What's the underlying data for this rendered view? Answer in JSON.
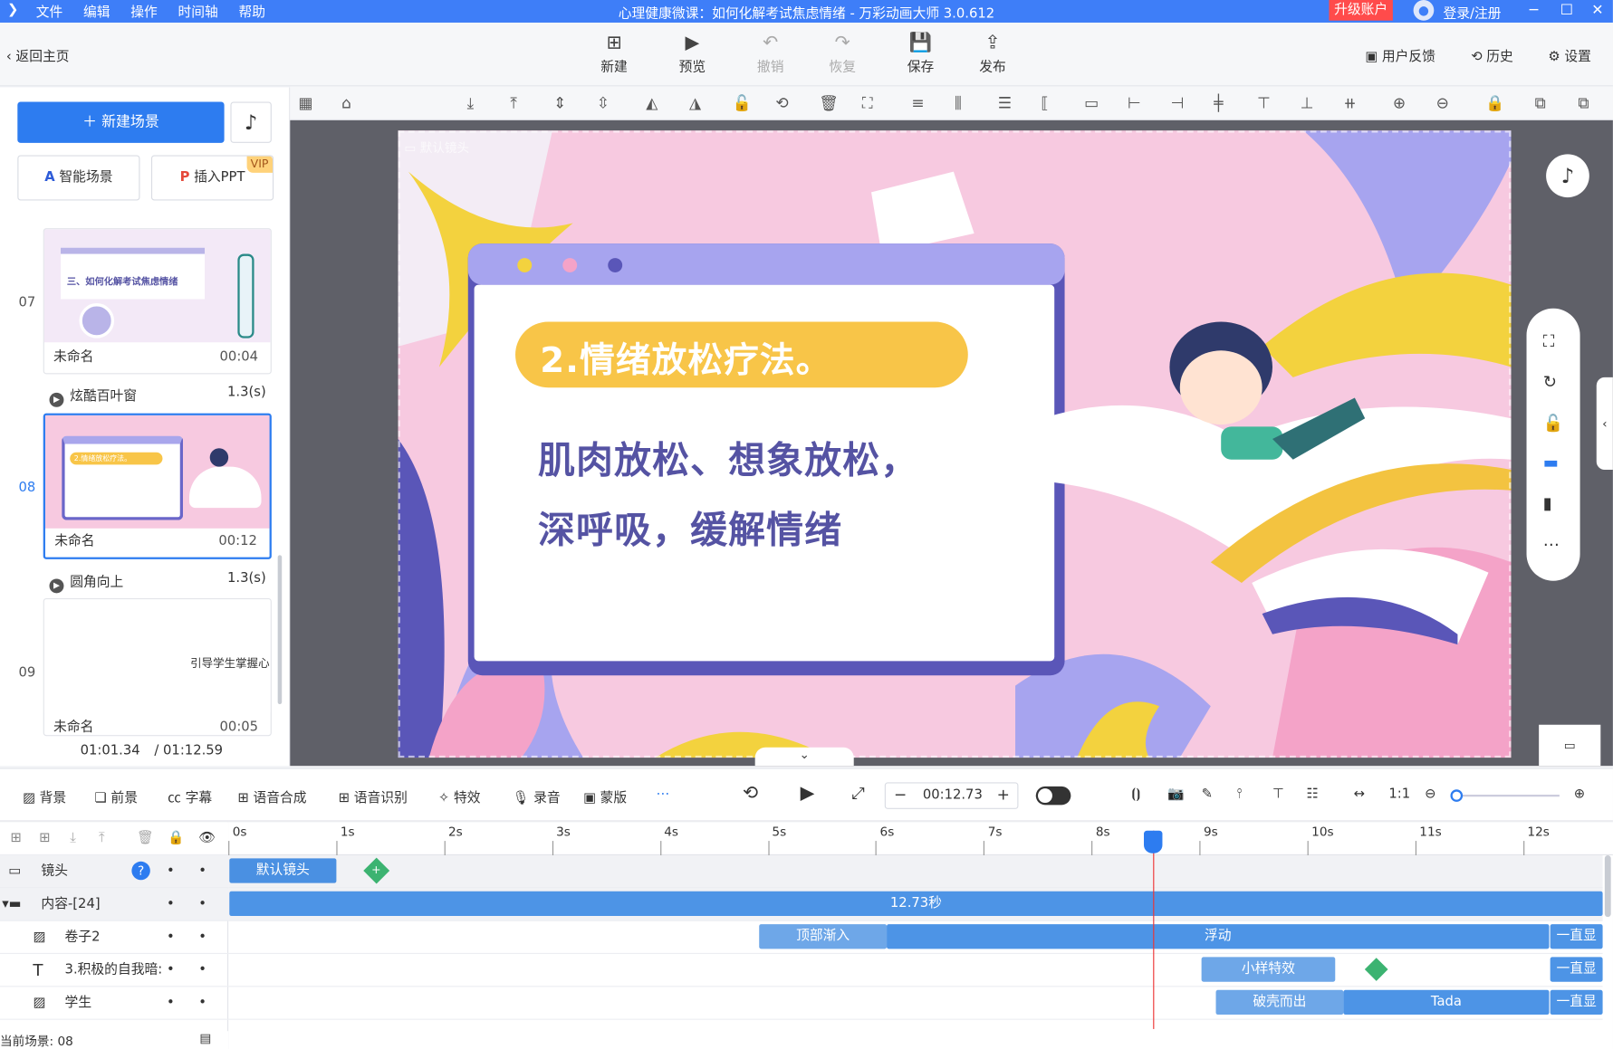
{
  "titlebar": {
    "menus": [
      "文件",
      "编辑",
      "操作",
      "时间轴",
      "帮助"
    ],
    "title": "心理健康微课：如何化解考试焦虑情绪 - 万彩动画大师 3.0.612",
    "upgrade": "升级账户",
    "login": "登录/注册"
  },
  "toolbar": {
    "back": "返回主页",
    "new": "新建",
    "preview": "预览",
    "undo": "撤销",
    "redo": "恢复",
    "save": "保存",
    "publish": "发布",
    "feedback": "用户反馈",
    "history": "历史",
    "settings": "设置"
  },
  "leftpanel": {
    "new_scene": "＋ 新建场景",
    "smart_scene": "智能场景",
    "insert_ppt": "插入PPT",
    "vip": "VIP",
    "scenes": [
      {
        "num": "07",
        "name": "未命名",
        "duration": "00:04",
        "thumb_text": "三、如何化解考试焦虑情绪"
      },
      {
        "num": "08",
        "name": "未命名",
        "duration": "00:12",
        "thumb_text": "2.情绪放松疗法。"
      },
      {
        "num": "09",
        "name": "未命名",
        "duration": "00:05",
        "thumb_text": "引导学生掌握心"
      }
    ],
    "transitions": [
      {
        "name": "炫酷百叶窗",
        "duration": "1.3(s)"
      },
      {
        "name": "圆角向上",
        "duration": "1.3(s)"
      }
    ],
    "time_current": "01:01.34",
    "time_total": "/ 01:12.59"
  },
  "canvas": {
    "camera_label": "默认镜头",
    "heading": "2.情绪放松疗法。",
    "line1": "肌肉放松、想象放松，",
    "line2": "深呼吸，缓解情绪"
  },
  "timeline_toolbar": {
    "background": "背景",
    "foreground": "前景",
    "subtitle": "字幕",
    "tts": "语音合成",
    "asr": "语音识别",
    "effects": "特效",
    "record": "录音",
    "mask": "蒙版",
    "time": "00:12.73"
  },
  "timeline": {
    "ticks": [
      "0s",
      "1s",
      "2s",
      "3s",
      "4s",
      "5s",
      "6s",
      "7s",
      "8s",
      "9s",
      "10s",
      "11s",
      "12s"
    ],
    "tracks": [
      {
        "name": "镜头"
      },
      {
        "name": "内容-[24]"
      },
      {
        "name": "卷子2"
      },
      {
        "name": "3.积极的自我暗:"
      },
      {
        "name": "学生"
      }
    ],
    "blocks": {
      "camera": "默认镜头",
      "content": "12.73秒",
      "juanzi_in": "顶部渐入",
      "juanzi_float": "浮动",
      "always": "一直显",
      "text_fx": "小样特效",
      "student_in": "破壳而出",
      "student_tada": "Tada"
    },
    "playhead_seconds": 8.57,
    "status": "当前场景: 08"
  },
  "colors": {
    "accent": "#2d7cf0",
    "titlebar": "#3e7ef8",
    "canvas_pink": "#f7c9e0",
    "heading_yellow": "#f8c548",
    "text_purple": "#5553a3"
  }
}
